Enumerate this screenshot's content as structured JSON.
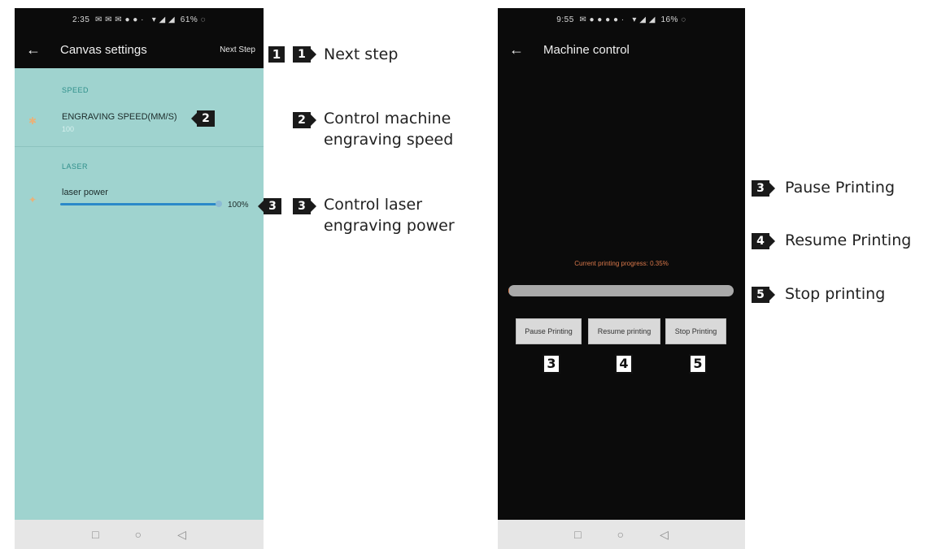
{
  "left_phone": {
    "status_time": "2:35",
    "status_battery": "61%",
    "title": "Canvas settings",
    "next_step": "Next Step",
    "speed_section": "SPEED",
    "speed_title": "ENGRAVING SPEED(MM/S)",
    "speed_value": "100",
    "laser_section": "LASER",
    "laser_title": "laser power",
    "laser_value": "100%",
    "laser_level_percent": 100
  },
  "right_phone": {
    "status_time": "9:55",
    "status_battery": "16%",
    "title": "Machine control",
    "progress_text": "Current printing progress: 0.35%",
    "progress_percent": 0.35,
    "buttons": [
      "Pause Printing",
      "Resume printing",
      "Stop Printing"
    ]
  },
  "annotations": {
    "left": [
      {
        "num": "1",
        "text_lines": [
          "Next step"
        ]
      },
      {
        "num": "2",
        "text_lines": [
          "Control machine",
          "engraving speed"
        ]
      },
      {
        "num": "3",
        "text_lines": [
          "Control laser",
          "engraving power"
        ]
      }
    ],
    "right": [
      {
        "num": "3",
        "text": "Pause Printing"
      },
      {
        "num": "4",
        "text": "Resume Printing"
      },
      {
        "num": "5",
        "text": "Stop printing"
      }
    ],
    "button_tags": [
      "3",
      "4",
      "5"
    ]
  },
  "colors": {
    "teal_bg": "#9fd3cf",
    "dark_bg": "#0b0b0b",
    "slider": "#2b89c9",
    "progress_text": "#d9784a"
  }
}
